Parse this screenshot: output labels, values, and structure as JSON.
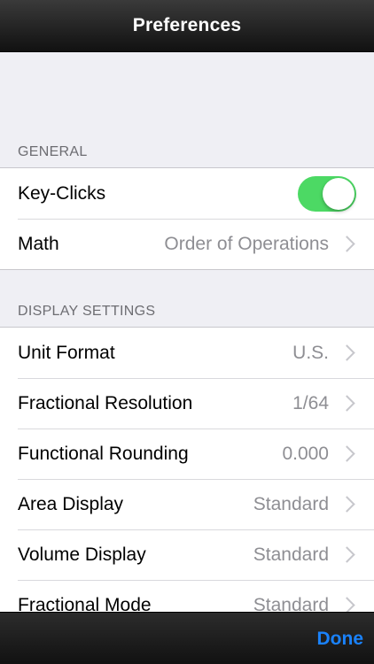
{
  "nav": {
    "title": "Preferences"
  },
  "general": {
    "header": "GENERAL",
    "key_clicks": {
      "label": "Key-Clicks",
      "enabled": true
    },
    "math": {
      "label": "Math",
      "value": "Order of Operations"
    }
  },
  "display": {
    "header": "DISPLAY SETTINGS",
    "rows": [
      {
        "label": "Unit Format",
        "value": "U.S."
      },
      {
        "label": "Fractional Resolution",
        "value": "1/64"
      },
      {
        "label": "Functional Rounding",
        "value": "0.000"
      },
      {
        "label": "Area Display",
        "value": "Standard"
      },
      {
        "label": "Volume Display",
        "value": "Standard"
      },
      {
        "label": "Fractional Mode",
        "value": "Standard"
      }
    ]
  },
  "toolbar": {
    "done_label": "Done"
  },
  "colors": {
    "toggle_on": "#4cd964",
    "accent": "#1a82fb",
    "background": "#efeff4"
  },
  "icons": {
    "chevron": "chevron-right-icon"
  }
}
